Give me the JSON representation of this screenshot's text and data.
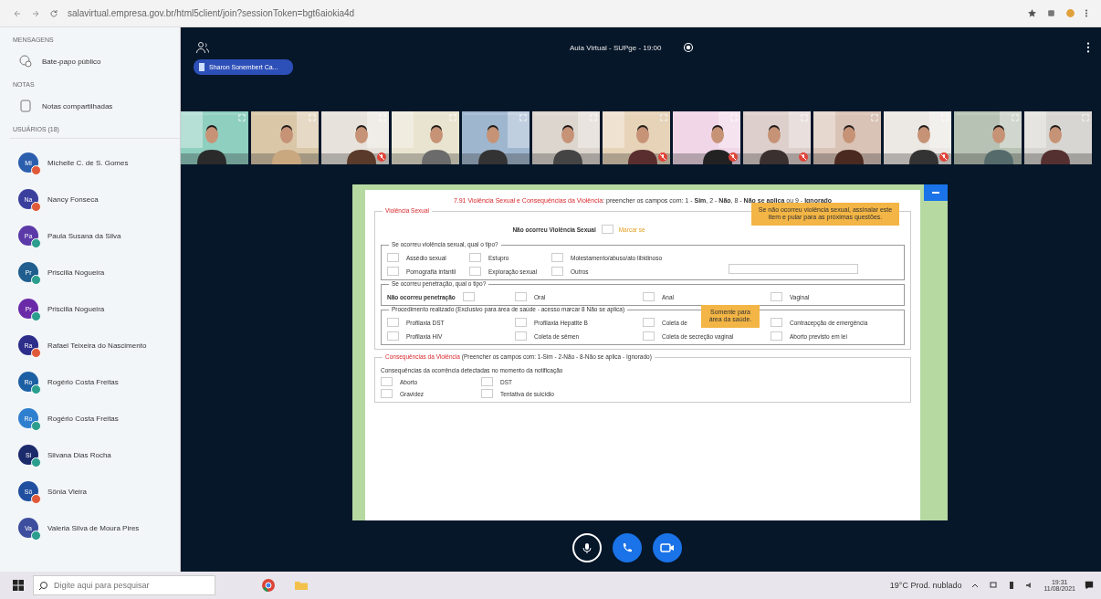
{
  "browser": {
    "url": "salavirtual.empresa.gov.br/html5client/join?sessionToken=bgt6aiokia4d"
  },
  "sidebar": {
    "messages": {
      "heading": "MENSAGENS",
      "item": "Bate-papo público"
    },
    "notes": {
      "heading": "NOTAS",
      "item": "Notas compartilhadas"
    },
    "users": {
      "heading": "USUÁRIOS (18)",
      "list": [
        {
          "initials": "Mi",
          "name": "Michelle C. de S. Gomes",
          "color": "#2b5fae",
          "muted": true
        },
        {
          "initials": "Na",
          "name": "Nancy Fonseca",
          "color": "#3a3f9e",
          "muted": true
        },
        {
          "initials": "Pa",
          "name": "Paula Susana da Silva",
          "color": "#5b3aa8",
          "muted": false
        },
        {
          "initials": "Pr",
          "name": "Priscilla Nogueira",
          "color": "#1f5e8e",
          "muted": false
        },
        {
          "initials": "Pr",
          "name": "Priscilla Nogueira",
          "color": "#6a2aa8",
          "muted": false
        },
        {
          "initials": "Ra",
          "name": "Rafael Teixeira do Nascimento",
          "color": "#2d2d8a",
          "muted": true
        },
        {
          "initials": "Ro",
          "name": "Rogério Costa Freitas",
          "color": "#1d5fa3",
          "muted": false
        },
        {
          "initials": "Ro",
          "name": "Rogério Costa Freitas",
          "color": "#2f7fcf",
          "muted": false
        },
        {
          "initials": "Si",
          "name": "Silvana Dias Rocha",
          "color": "#1b2a6b",
          "muted": false
        },
        {
          "initials": "Sô",
          "name": "Sônia Vieira",
          "color": "#1f4f9e",
          "muted": true
        },
        {
          "initials": "Va",
          "name": "Valeria Silva de Moura Pires",
          "color": "#3d4e9e",
          "muted": false
        }
      ]
    }
  },
  "meeting": {
    "title": "Aula Virtual - SUPge - 19:00",
    "presenter": "Sharon Sonembert Ca...",
    "videos": [
      {
        "muted": false
      },
      {
        "muted": false
      },
      {
        "muted": true
      },
      {
        "muted": false
      },
      {
        "muted": false
      },
      {
        "muted": false
      },
      {
        "muted": true
      },
      {
        "muted": true
      },
      {
        "muted": true
      },
      {
        "muted": false
      },
      {
        "muted": true
      },
      {
        "muted": false
      },
      {
        "muted": false
      }
    ]
  },
  "slide": {
    "title_red": "7.91 Violência Sexual e Consequências da Violência",
    "title_rest": ": preencher os campos com: 1 - **Sim**, 2 - **Não**, 8 - **Não se aplica** ou 9 - **Ignorado**",
    "section": "Violência Sexual",
    "none_label": "Não ocorreu Violência Sexual",
    "none_checked": false,
    "none_hint": "Marcar se",
    "callout_1": "Se não ocorreu violência sexual, assinalar este item e pular para as próximas questões.",
    "type_group": {
      "legend": "Se ocorreu violência sexual, qual o tipo?",
      "options": [
        {
          "label": "Assédio sexual",
          "checked": false
        },
        {
          "label": "Estupro",
          "checked": false
        },
        {
          "label": "Molestamento/abuso/ato libidinoso",
          "checked": false
        },
        {
          "label": "Pornografia infantil",
          "checked": false
        },
        {
          "label": "Exploração sexual",
          "checked": false
        },
        {
          "label": "Outros",
          "checked": false
        }
      ]
    },
    "penetration_group": {
      "legend": "Se ocorreu penetração, qual o tipo?",
      "none_label": "Não ocorreu penetração",
      "none_checked": false,
      "options": [
        {
          "label": "Oral",
          "checked": false
        },
        {
          "label": "Anal",
          "checked": false
        },
        {
          "label": "Vaginal",
          "checked": false
        }
      ]
    },
    "procedure_group": {
      "legend": "Procedimento realizado (Exclusivo para área de saúde - acesso marcar 8 Não se aplica)",
      "options": [
        {
          "label": "Profilaxia DST",
          "checked": false
        },
        {
          "label": "Profilaxia Hepatite B",
          "checked": false
        },
        {
          "label": "Coleta de",
          "checked": false
        },
        {
          "label": "Contracepção de emergência",
          "checked": false
        },
        {
          "label": "Profilaxia HIV",
          "checked": false
        },
        {
          "label": "Coleta de sêmen",
          "checked": false
        },
        {
          "label": "Coleta de secreção vaginal",
          "checked": false
        },
        {
          "label": "Aborto previsto em lei",
          "checked": false
        }
      ]
    },
    "callout_2": "Somente para área da saúde.",
    "consequences": {
      "legend_red": "Consequências da Violência",
      "legend_rest": " (Preencher os campos com: 1-Sim - 2-Não - 8-Não se aplica - Ignorado)",
      "subtitle": "Consequências da ocorrência detectadas no momento da notificação",
      "options": [
        {
          "label": "Aborto",
          "checked": false
        },
        {
          "label": "DST",
          "checked": false
        },
        {
          "label": "Gravidez",
          "checked": false
        },
        {
          "label": "Tentativa de suicídio",
          "checked": false
        }
      ]
    }
  },
  "taskbar": {
    "search_placeholder": "Digite aqui para pesquisar",
    "weather": "19°C Prod. nublado",
    "time": "19:31",
    "date": "11/08/2021"
  }
}
